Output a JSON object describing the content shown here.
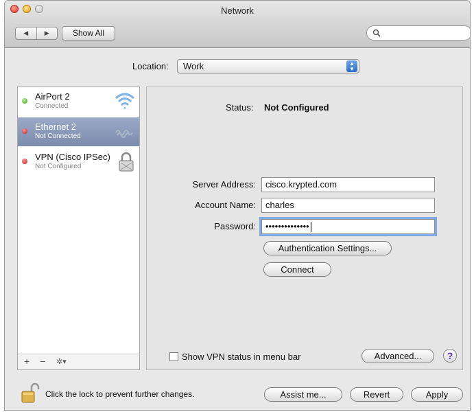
{
  "window": {
    "title": "Network"
  },
  "toolbar": {
    "back_glyph": "◀",
    "forward_glyph": "▶",
    "show_all_label": "Show All",
    "search_placeholder": ""
  },
  "location": {
    "label": "Location:",
    "value": "Work"
  },
  "services": [
    {
      "name": "AirPort 2",
      "status": "Connected",
      "status_color": "green",
      "icon": "wifi-icon",
      "selected": false
    },
    {
      "name": "Ethernet 2",
      "status": "Not Connected",
      "status_color": "red",
      "icon": "ethernet-icon",
      "selected": true
    },
    {
      "name": "VPN (Cisco IPSec)",
      "status": "Not Configured",
      "status_color": "red",
      "icon": "lock-icon",
      "selected": false
    }
  ],
  "sidebar_footer": {
    "add": "+",
    "remove": "−",
    "gear": "✲▾"
  },
  "detail": {
    "status_label": "Status:",
    "status_value": "Not Configured",
    "server_address_label": "Server Address:",
    "server_address_value": "cisco.krypted.com",
    "account_name_label": "Account Name:",
    "account_name_value": "charles",
    "password_label": "Password:",
    "password_value": "••••••••••••••",
    "auth_settings_label": "Authentication Settings...",
    "connect_label": "Connect",
    "show_vpn_status_label": "Show VPN status in menu bar",
    "show_vpn_status_checked": false,
    "advanced_label": "Advanced...",
    "help_label": "?"
  },
  "bottom": {
    "lock_text": "Click the lock to prevent further changes.",
    "assist_label": "Assist me...",
    "revert_label": "Revert",
    "apply_label": "Apply"
  },
  "colors": {
    "selection": "#8394b6",
    "focus_ring": "#7eaae6",
    "status_red": "#c11717",
    "status_green": "#3e9f1c"
  }
}
